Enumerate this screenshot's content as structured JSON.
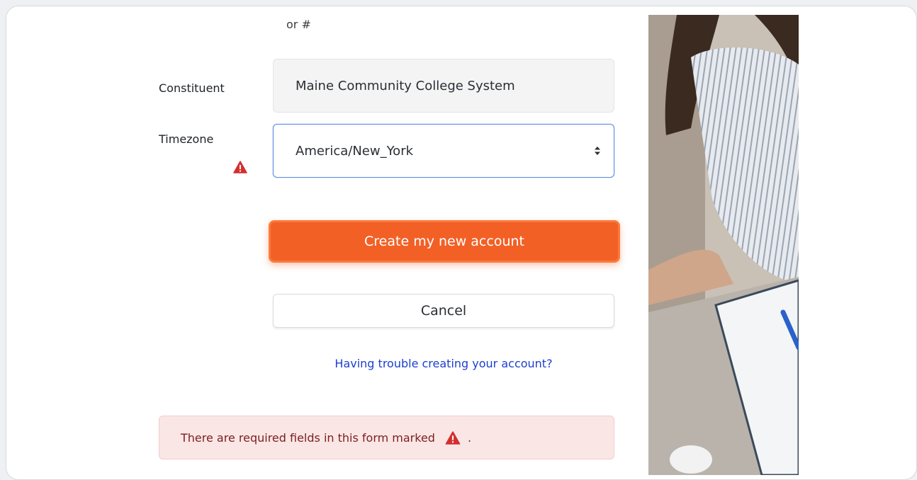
{
  "form": {
    "hint_text": "or #",
    "constituent": {
      "label": "Constituent",
      "value": "Maine Community College System"
    },
    "timezone": {
      "label": "Timezone",
      "value": "America/New_York",
      "warning_icon": "warning-triangle-icon"
    },
    "create_button_label": "Create my new account",
    "cancel_button_label": "Cancel",
    "help_link_text": "Having trouble creating your account?",
    "required_notice": {
      "text_before": "There are required fields in this form marked",
      "text_after": "."
    }
  },
  "colors": {
    "primary_button": "#f26026",
    "focus_border": "#5b8de0",
    "link": "#1c3fcf",
    "alert_bg": "#fbe6e6",
    "warning_icon": "#d32f2f"
  }
}
